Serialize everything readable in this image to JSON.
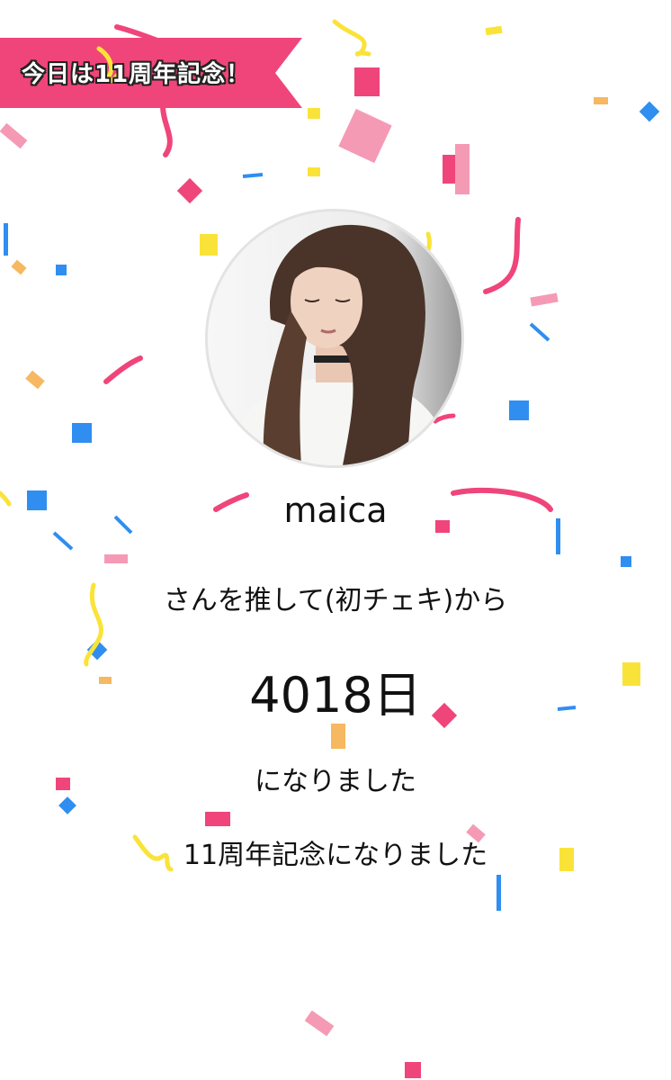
{
  "banner": {
    "text": "今日は11周年記念！",
    "color": "#f0457a"
  },
  "profile": {
    "name": "maica",
    "avatar_alt": "profile-photo"
  },
  "message": {
    "since": "さんを推して(初チェキ)から",
    "days": "4018日",
    "became": "になりました",
    "anniversary": "11周年記念になりました"
  },
  "colors": {
    "pink": "#f0457a",
    "light_pink": "#f59ab5",
    "yellow": "#fae339",
    "blue": "#2f8ef0",
    "orange": "#f6b861"
  }
}
